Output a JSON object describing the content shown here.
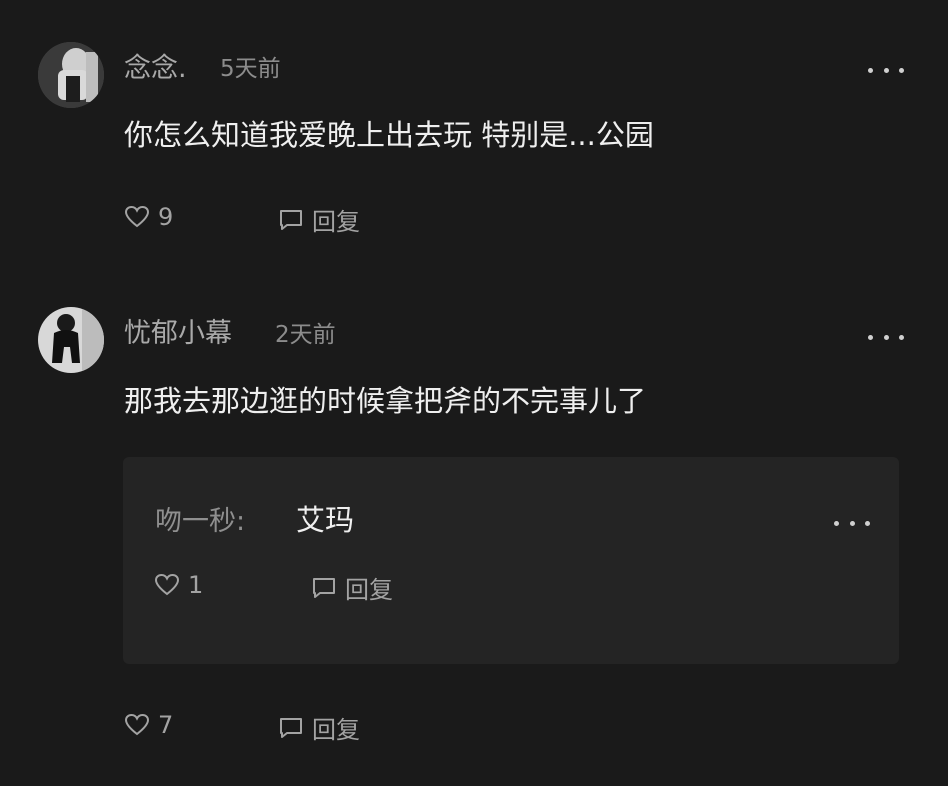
{
  "comments": [
    {
      "username": "念念.",
      "time": "5天前",
      "content": "你怎么知道我爱晚上出去玩 特别是...公园",
      "likes": "9",
      "reply_label": "回复"
    },
    {
      "username": "忧郁小幕",
      "time": "2天前",
      "content": "那我去那边逛的时候拿把斧的不完事儿了",
      "likes": "7",
      "reply_label": "回复",
      "nested_reply": {
        "author": "吻一秒:",
        "content": "艾玛",
        "likes": "1",
        "reply_label": "回复"
      }
    }
  ],
  "icons": {
    "like": "heart-outline-icon",
    "reply": "speech-bubble-icon",
    "more": "ellipsis-icon"
  },
  "colors": {
    "background": "#1a1a1a",
    "reply_box": "#242424",
    "text_primary": "#efefef",
    "text_secondary": "#a3a3a3"
  }
}
